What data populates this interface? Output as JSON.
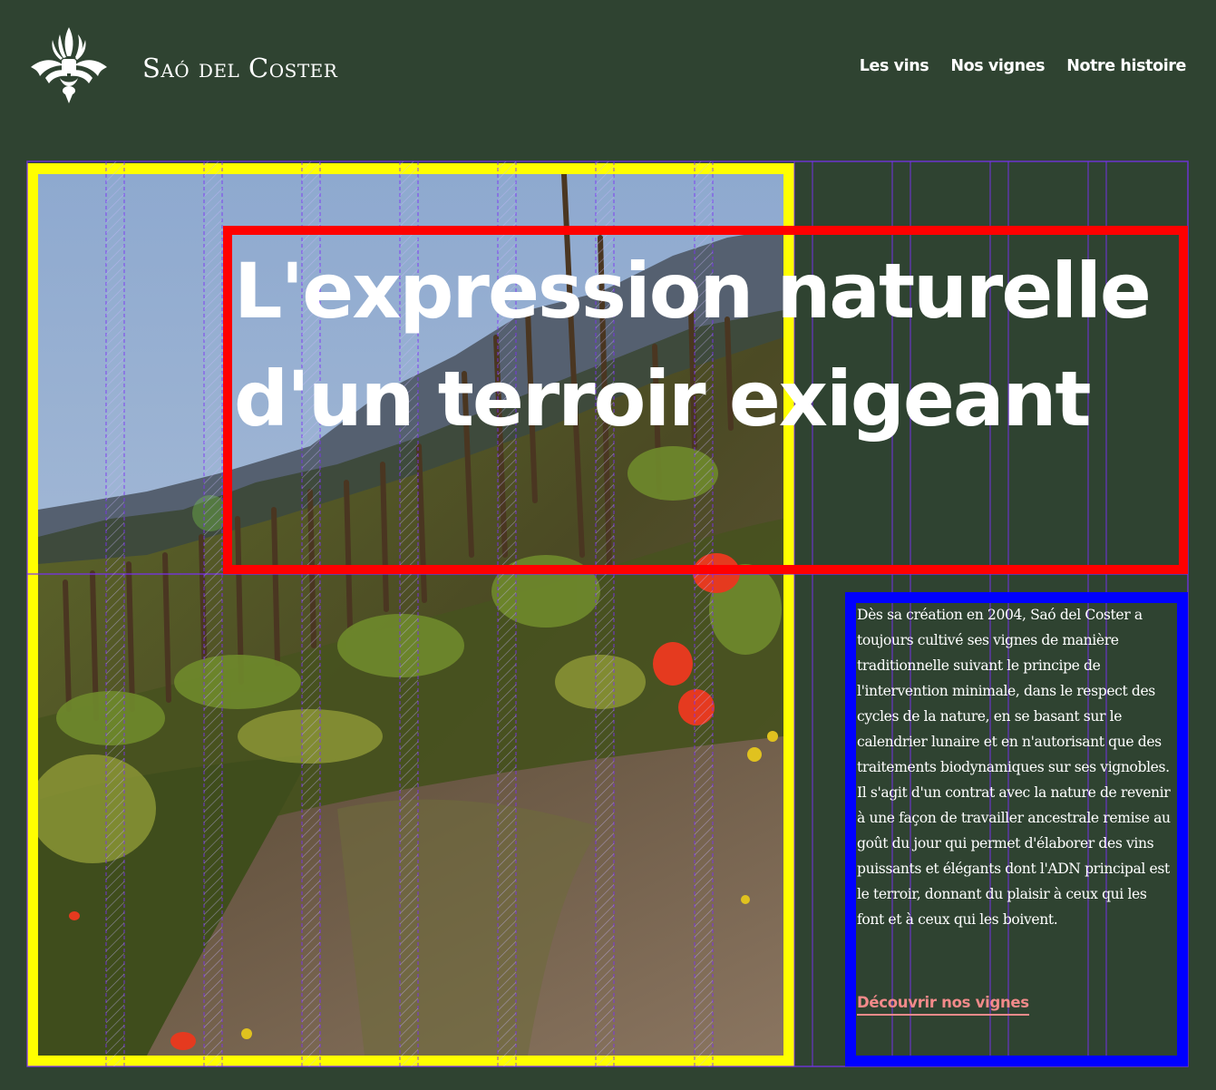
{
  "header": {
    "logo_icon": "fleur-de-lis-icon",
    "brand": "Saó del Coster",
    "nav": [
      {
        "label": "Les vins"
      },
      {
        "label": "Nos vignes"
      },
      {
        "label": "Notre histoire"
      }
    ]
  },
  "hero": {
    "image": "vineyard-hillside-image",
    "headline": "L'expression naturelle d'un terroir exigeant"
  },
  "intro": {
    "text": "Dès sa création en 2004, Saó del Coster a toujours cultivé ses vignes de manière traditionnelle suivant le principe de l'intervention minimale, dans le respect des cycles de la nature, en se basant sur le calendrier lunaire et en n'autorisant que des traitements biodynamiques sur ses vignobles. Il s'agit d'un contrat avec la nature de revenir à une façon de travailler ancestrale remise au goût du jour qui permet d'élaborer des vins puissants et élégants dont l'ADN principal est le terroir, donnant du plaisir à ceux qui les font et à ceux qui les boivent.",
    "cta": "Découvrir nos vignes"
  },
  "colors": {
    "background": "#2f4331",
    "text": "#ffffff",
    "cta": "#f28a8a",
    "overlay_image": "#ffff00",
    "overlay_headline": "#ff0000",
    "overlay_text": "#0000ff",
    "overlay_grid": "#7b2ff7"
  }
}
